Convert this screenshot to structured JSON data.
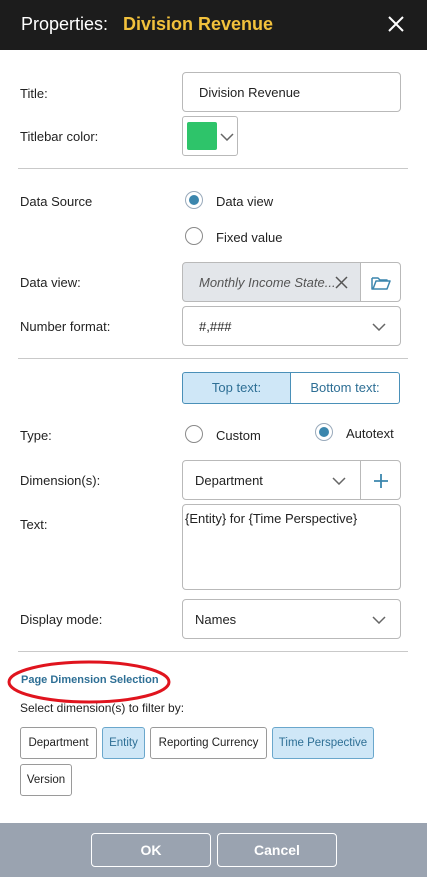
{
  "header": {
    "label": "Properties:",
    "title": "Division Revenue"
  },
  "title_field": {
    "label": "Title:",
    "value": "Division Revenue"
  },
  "titlebar_color": {
    "label": "Titlebar color:",
    "color": "#2ec46a"
  },
  "data_source": {
    "label": "Data Source",
    "options": [
      {
        "label": "Data view",
        "selected": true
      },
      {
        "label": "Fixed value",
        "selected": false
      }
    ]
  },
  "data_view": {
    "label": "Data view:",
    "value": "Monthly Income State..."
  },
  "number_format": {
    "label": "Number format:",
    "value": "#,###"
  },
  "text_tabs": {
    "top": "Top text:",
    "bottom": "Bottom text:"
  },
  "type": {
    "label": "Type:",
    "options": [
      {
        "label": "Custom",
        "selected": false
      },
      {
        "label": "Autotext",
        "selected": true
      }
    ]
  },
  "dimensions": {
    "label": "Dimension(s):",
    "value": "Department"
  },
  "text": {
    "label": "Text:",
    "value": "{Entity} for {Time Perspective}"
  },
  "display_mode": {
    "label": "Display mode:",
    "value": "Names"
  },
  "page_dimension": {
    "heading": "Page Dimension Selection",
    "subtitle": "Select dimension(s) to filter by:",
    "chips": [
      {
        "label": "Department",
        "selected": false
      },
      {
        "label": "Entity",
        "selected": true
      },
      {
        "label": "Reporting Currency",
        "selected": false
      },
      {
        "label": "Time Perspective",
        "selected": true
      },
      {
        "label": "Version",
        "selected": false
      }
    ]
  },
  "footer": {
    "ok": "OK",
    "cancel": "Cancel"
  }
}
